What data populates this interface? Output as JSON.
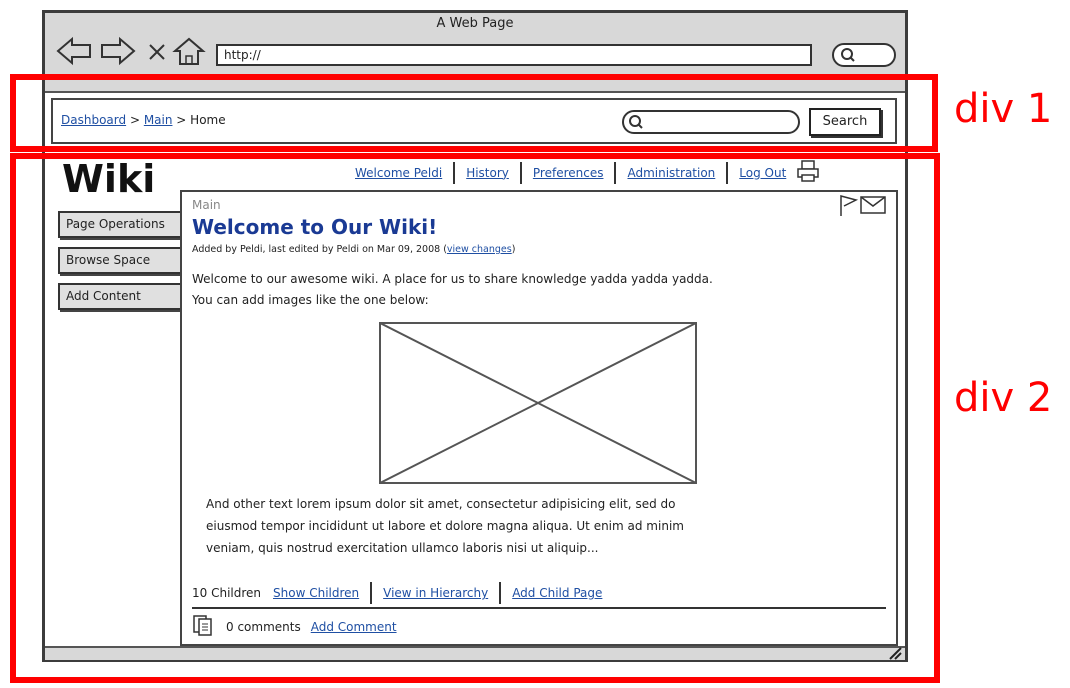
{
  "browser": {
    "window_title": "A Web Page",
    "url": "http://"
  },
  "header": {
    "breadcrumbs": [
      "Dashboard",
      "Main",
      "Home"
    ],
    "search_placeholder": "",
    "search_button": "Search"
  },
  "annotations": {
    "div1": "div 1",
    "div2": "div 2"
  },
  "wiki": {
    "logo": "Wiki",
    "topnav": [
      "Welcome Peldi",
      "History",
      "Preferences",
      "Administration",
      "Log Out"
    ],
    "sidebar": [
      "Page Operations",
      "Browse Space",
      "Add Content"
    ],
    "page": {
      "context": "Main",
      "title": "Welcome to Our Wiki!",
      "meta_prefix": "Added by Peldi, last edited by Peldi on Mar 09, 2008 (",
      "meta_link": "view changes",
      "meta_suffix": ")",
      "intro_line1": "Welcome to our awesome wiki. A place for us to share knowledge yadda yadda yadda.",
      "intro_line2": "You can add images like the one below:",
      "body_lines": [
        "And other text lorem ipsum dolor sit amet, consectetur adipisicing elit, sed do",
        "eiusmod tempor incididunt ut labore et dolore magna aliqua. Ut enim ad minim",
        "veniam, quis nostrud exercitation ullamco laboris nisi ut aliquip..."
      ],
      "children_count": "10 Children",
      "children_links": [
        "Show Children",
        "View in Hierarchy",
        "Add Child Page"
      ],
      "comments_count": "0 comments",
      "add_comment": "Add Comment"
    }
  },
  "colors": {
    "annotation_red": "#ff0000",
    "link_blue": "#1f4fa3",
    "title_blue": "#1a3a94",
    "chrome_gray": "#d8d8d8"
  },
  "icons": [
    "back-arrow-icon",
    "forward-arrow-icon",
    "close-x-icon",
    "home-icon",
    "magnifier-icon",
    "printer-icon",
    "flag-icon",
    "envelope-icon",
    "document-icon",
    "resize-grip-icon"
  ]
}
